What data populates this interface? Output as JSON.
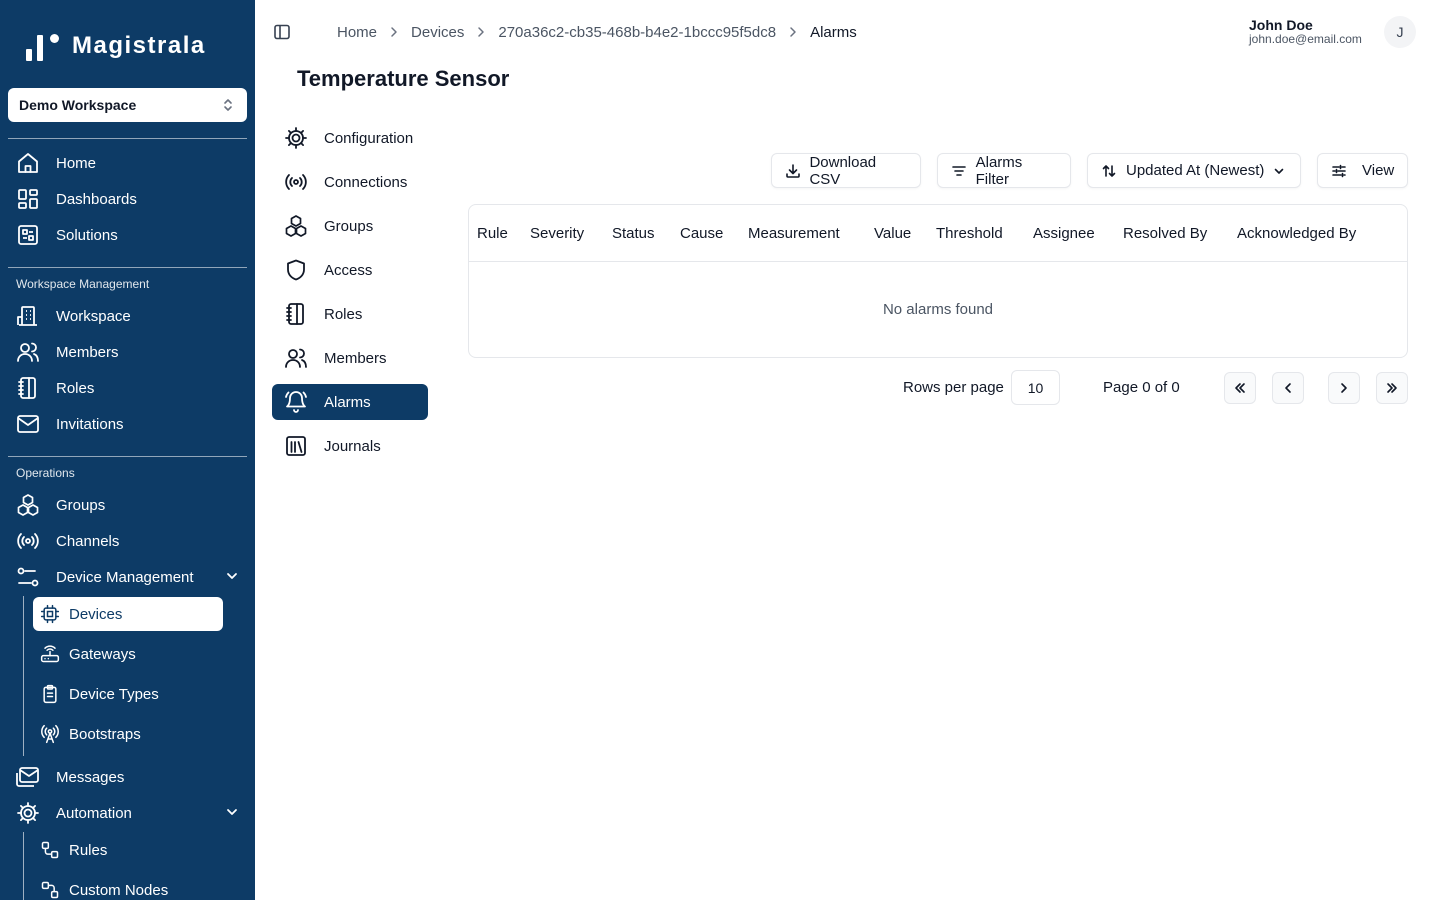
{
  "app": {
    "name": "Magistrala"
  },
  "workspace": {
    "selected": "Demo Workspace"
  },
  "sidebar": {
    "main": [
      {
        "label": "Home",
        "icon": "home-icon"
      },
      {
        "label": "Dashboards",
        "icon": "dashboard-icon"
      },
      {
        "label": "Solutions",
        "icon": "solutions-icon"
      }
    ],
    "workspace_section": "Workspace Management",
    "workspace_items": [
      {
        "label": "Workspace",
        "icon": "building-icon"
      },
      {
        "label": "Members",
        "icon": "users-icon"
      },
      {
        "label": "Roles",
        "icon": "notebook-icon"
      },
      {
        "label": "Invitations",
        "icon": "mail-icon"
      }
    ],
    "operations_section": "Operations",
    "operations_items": [
      {
        "label": "Groups",
        "icon": "boxes-icon"
      },
      {
        "label": "Channels",
        "icon": "radio-icon"
      },
      {
        "label": "Device Management",
        "icon": "route-icon"
      }
    ],
    "device_sub": [
      {
        "label": "Devices",
        "icon": "cpu-icon"
      },
      {
        "label": "Gateways",
        "icon": "router-icon"
      },
      {
        "label": "Device Types",
        "icon": "clipboard-icon"
      },
      {
        "label": "Bootstraps",
        "icon": "antenna-icon"
      }
    ],
    "more_items": [
      {
        "label": "Messages",
        "icon": "mail-open-icon"
      },
      {
        "label": "Automation",
        "icon": "gear-icon"
      }
    ],
    "automation_sub": [
      {
        "label": "Rules",
        "icon": "workflow-icon"
      },
      {
        "label": "Custom Nodes",
        "icon": "nodes-icon"
      }
    ]
  },
  "breadcrumb": [
    "Home",
    "Devices",
    "270a36c2-cb35-468b-b4e2-1bccc95f5dc8",
    "Alarms"
  ],
  "user": {
    "name": "John Doe",
    "email": "john.doe@email.com",
    "initial": "J"
  },
  "page": {
    "title": "Temperature Sensor"
  },
  "device_nav": [
    {
      "label": "Configuration",
      "icon": "gear-icon"
    },
    {
      "label": "Connections",
      "icon": "radio-icon"
    },
    {
      "label": "Groups",
      "icon": "boxes-icon"
    },
    {
      "label": "Access",
      "icon": "shield-icon"
    },
    {
      "label": "Roles",
      "icon": "notebook-icon"
    },
    {
      "label": "Members",
      "icon": "users-icon"
    },
    {
      "label": "Alarms",
      "icon": "bell-icon",
      "active": true
    },
    {
      "label": "Journals",
      "icon": "journal-icon"
    }
  ],
  "toolbar": {
    "download_csv": "Download CSV",
    "alarms_filter": "Alarms Filter",
    "sort": "Updated At (Newest)",
    "view": "View"
  },
  "table": {
    "columns": [
      "Rule",
      "Severity",
      "Status",
      "Cause",
      "Measurement",
      "Value",
      "Threshold",
      "Assignee",
      "Resolved By",
      "Acknowledged By"
    ],
    "empty": "No alarms found"
  },
  "pagination": {
    "rows_label": "Rows per page",
    "rows_value": "10",
    "page_info": "Page 0 of 0"
  },
  "colors": {
    "sidebar_bg": "#0d3b66",
    "accent": "#0d3b66"
  }
}
